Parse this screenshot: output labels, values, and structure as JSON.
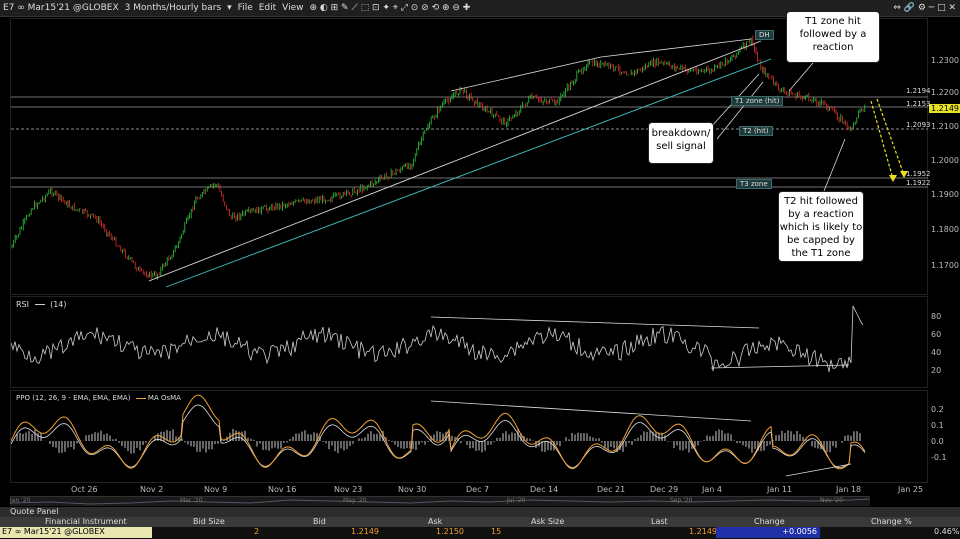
{
  "titlebar": {
    "symbol": "E7 ∞ Mar15'21 @GLOBEX",
    "interval": "3 Months/Hourly bars",
    "menu": [
      "File",
      "Edit",
      "View"
    ]
  },
  "price_axis": {
    "ticks": [
      "1.2300",
      "1.2200",
      "1.2100",
      "1.2000",
      "1.1900",
      "1.1800",
      "1.1700"
    ],
    "levels": [
      {
        "label": "1.2194"
      },
      {
        "label": "1.2153"
      },
      {
        "label": "1.2093"
      },
      {
        "label": "1.1952"
      },
      {
        "label": "1.1922"
      }
    ],
    "last_price": "1.2149"
  },
  "tags": {
    "dh": "DH",
    "t1": "T1 zone (hit)",
    "t2": "T2 (hit)",
    "t3": "T3 zone"
  },
  "callouts": {
    "c1": [
      "T1 zone hit",
      "followed by a",
      "reaction"
    ],
    "c2": [
      "breakdown/",
      "sell signal"
    ],
    "c3": [
      "T2 hit followed",
      "by a reaction",
      "which is likely to",
      "be capped by",
      "the T1 zone"
    ]
  },
  "rsi": {
    "label": "RSI",
    "param": "(14)",
    "ticks": [
      "80",
      "60",
      "40",
      "20"
    ]
  },
  "ppo": {
    "label": "PPO",
    "param": "(12, 26, 9 - EMA, EMA, EMA)",
    "ma": "MA",
    "osma": "OsMA",
    "ticks": [
      "0.2",
      "0.1",
      "0.0",
      "-0.1"
    ]
  },
  "time_axis": {
    "labels": [
      "Oct 26",
      "Nov 2",
      "Nov 9",
      "Nov 16",
      "Nov 23",
      "Nov 30",
      "Dec 7",
      "Dec 14",
      "Dec 21",
      "Dec 29",
      "Jan 4",
      "Jan 11",
      "Jan 18",
      "Jan 25"
    ],
    "overview_labels": [
      "Jan '20",
      "Mar '20",
      "May '20",
      "Jul '20",
      "Sep '20",
      "Nov '20"
    ]
  },
  "quote_panel": {
    "title": "Quote Panel",
    "headers": [
      "Financial Instrument",
      "Bid Size",
      "Bid",
      "Ask",
      "Ask Size",
      "Last",
      "Change",
      "Change %"
    ],
    "row": {
      "instrument": "E7 ∞ Mar15'21 @GLOBEX",
      "bid_size": "2",
      "bid": "1.2149",
      "ask": "1.2150",
      "ask_size": "15",
      "last": "1.2149",
      "change": "+0.0056",
      "change_pct": "0.46%"
    }
  },
  "colors": {
    "up": "#2ecc40",
    "down": "#e03030",
    "teal": "#40c0c0",
    "orange": "#f0a030",
    "yellow": "#e8e020"
  }
}
